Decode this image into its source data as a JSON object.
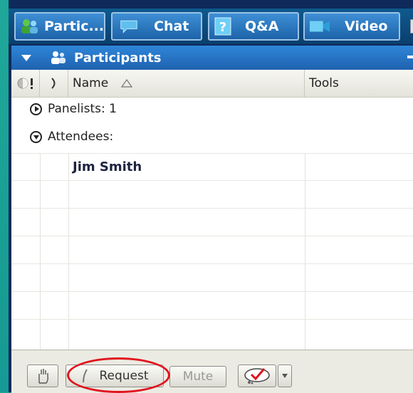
{
  "tabs": [
    {
      "label": "Partic...",
      "icon": "participants-icon"
    },
    {
      "label": "Chat",
      "icon": "chat-bubble-icon"
    },
    {
      "label": "Q&A",
      "icon": "question-icon"
    },
    {
      "label": "Video",
      "icon": "video-camera-icon"
    }
  ],
  "panel": {
    "title": "Participants"
  },
  "columns": {
    "name": "Name",
    "tools": "Tools"
  },
  "groups": {
    "panelists": "Panelists: 1",
    "attendees": "Attendees:"
  },
  "attendee_rows": [
    {
      "name": "Jim Smith"
    }
  ],
  "footer": {
    "request_label": "Request",
    "mute_label": "Mute"
  },
  "colors": {
    "highlight": "#e0141e",
    "tab_blue": "#2a78c4",
    "header_blue": "#2f86d8"
  }
}
